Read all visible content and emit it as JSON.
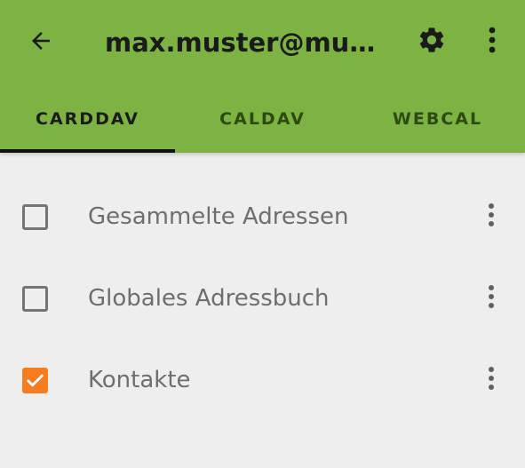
{
  "toolbar": {
    "title": "max.muster@must…",
    "back_icon": "arrow-back-icon",
    "settings_icon": "gear-icon",
    "overflow_icon": "more-vert-icon"
  },
  "tabs": [
    {
      "label": "CARDDAV",
      "active": true
    },
    {
      "label": "CALDAV",
      "active": false
    },
    {
      "label": "WEBCAL",
      "active": false
    }
  ],
  "addressbooks": [
    {
      "label": "Gesammelte Adressen",
      "checked": false
    },
    {
      "label": "Globales Adressbuch",
      "checked": false
    },
    {
      "label": "Kontakte",
      "checked": true
    }
  ],
  "colors": {
    "app_bar": "#7cb342",
    "background": "#eeeeee",
    "checkbox_checked": "#f57c1f",
    "tab_indicator": "#111111"
  }
}
